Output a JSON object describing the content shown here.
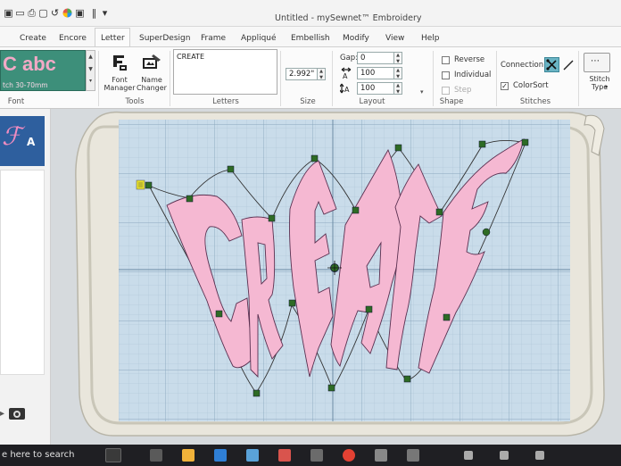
{
  "window": {
    "title": "Untitled - mySewnet™ Embroidery"
  },
  "quick_access": [
    "save-icon",
    "print-icon",
    "undo-icon",
    "redo-icon",
    "color-wheel-icon",
    "dropdown-icon"
  ],
  "ribbon_tabs": [
    {
      "label": "Create",
      "active": false
    },
    {
      "label": "Encore",
      "active": false
    },
    {
      "label": "Letter",
      "active": true
    },
    {
      "label": "SuperDesign",
      "active": false
    },
    {
      "label": "Frame",
      "active": false
    },
    {
      "label": "Appliqué",
      "active": false
    },
    {
      "label": "Embellish",
      "active": false
    },
    {
      "label": "Modify",
      "active": false
    },
    {
      "label": "View",
      "active": false
    },
    {
      "label": "Help",
      "active": false
    }
  ],
  "font_group": {
    "preview_text": "C abc",
    "preview_size": "tch 30-70mm",
    "label": "Font"
  },
  "tools_group": {
    "font_manager": "Font\nManager",
    "name_changer": "Name\nChanger",
    "label": "Tools"
  },
  "letters_group": {
    "text": "CREATE",
    "label": "Letters"
  },
  "size_group": {
    "value": "2.992\"",
    "label": "Size"
  },
  "layout_group": {
    "gap_label": "Gap:",
    "gap_value": "0",
    "width_value": "100",
    "height_value": "100",
    "label": "Layout"
  },
  "shape_group": {
    "reverse": {
      "label": "Reverse",
      "checked": false,
      "enabled": true
    },
    "individual": {
      "label": "Individual",
      "checked": false,
      "enabled": true
    },
    "step": {
      "label": "Step",
      "checked": false,
      "enabled": false
    },
    "label": "Shape"
  },
  "stitches_group": {
    "connection_label": "Connection:",
    "colorsort": {
      "label": "ColorSort",
      "checked": true
    },
    "stitch_type": "Stitch\nType",
    "label": "Stitches"
  },
  "taskbar": {
    "search_text": "e here to search"
  },
  "colors": {
    "accent_pink": "#f5b8d2",
    "outline": "#5a3050",
    "handle": "#2e6b24",
    "grid_bg": "#c9dcea",
    "hoop": "#e8e4d6"
  }
}
